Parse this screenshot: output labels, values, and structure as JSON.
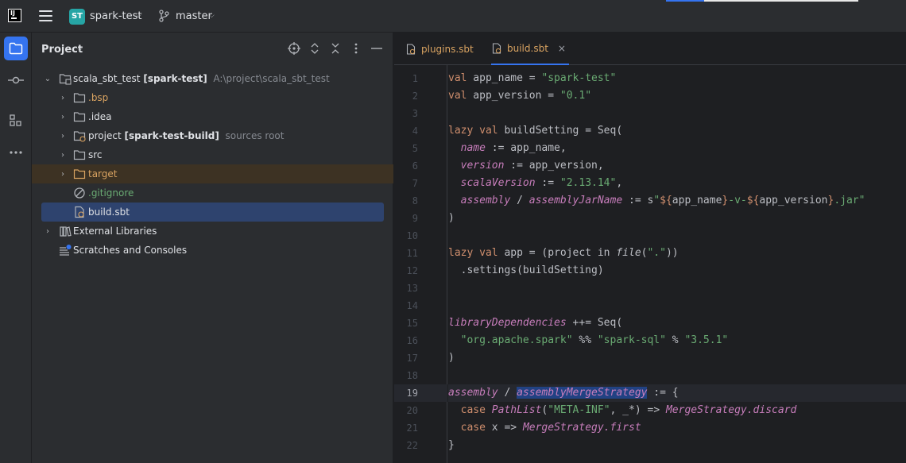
{
  "titlebar": {
    "logo_text": "IJ",
    "project_initials": "ST",
    "project_name": "spark-test",
    "branch": "master",
    "colors": {
      "project_badge": "#26a5a5",
      "accent": "#3574f0"
    }
  },
  "toolstrip": {
    "items": [
      "project-icon",
      "commit-icon",
      "structure-icon",
      "more-icon"
    ]
  },
  "project_panel": {
    "title": "Project",
    "tree": [
      {
        "label": "scala_sbt_test",
        "bold_suffix": "[spark-test]",
        "hint": "A:\\project\\scala_sbt_test",
        "icon": "module-folder-icon"
      },
      {
        "label": ".bsp",
        "icon": "folder-icon"
      },
      {
        "label": ".idea",
        "icon": "folder-icon"
      },
      {
        "label": "project",
        "bold_suffix": "[spark-test-build]",
        "hint": "sources root",
        "icon": "module-folder-icon"
      },
      {
        "label": "src",
        "icon": "folder-icon"
      },
      {
        "label": "target",
        "icon": "excluded-folder-icon"
      },
      {
        "label": ".gitignore",
        "icon": "ignored-file-icon"
      },
      {
        "label": "build.sbt",
        "icon": "sbt-file-icon"
      },
      {
        "label": "External Libraries",
        "icon": "libraries-icon"
      },
      {
        "label": "Scratches and Consoles",
        "icon": "scratches-icon"
      }
    ]
  },
  "editor": {
    "tabs": [
      {
        "label": "plugins.sbt",
        "active": false
      },
      {
        "label": "build.sbt",
        "active": true,
        "close": "×"
      }
    ],
    "current_line": 19,
    "lines": [
      [
        [
          "kw",
          "val"
        ],
        [
          "plain",
          " app_name = "
        ],
        [
          "str",
          "\"spark-test\""
        ]
      ],
      [
        [
          "kw",
          "val"
        ],
        [
          "plain",
          " app_version = "
        ],
        [
          "str",
          "\"0.1\""
        ]
      ],
      [],
      [
        [
          "kw",
          "lazy val"
        ],
        [
          "plain",
          " buildSetting = Seq("
        ]
      ],
      [
        [
          "plain",
          "  "
        ],
        [
          "it",
          "name"
        ],
        [
          "plain",
          " := app_name,"
        ]
      ],
      [
        [
          "plain",
          "  "
        ],
        [
          "it",
          "version"
        ],
        [
          "plain",
          " := app_version,"
        ]
      ],
      [
        [
          "plain",
          "  "
        ],
        [
          "it",
          "scalaVersion"
        ],
        [
          "plain",
          " := "
        ],
        [
          "str",
          "\"2.13.14\""
        ],
        [
          "plain",
          ","
        ]
      ],
      [
        [
          "plain",
          "  "
        ],
        [
          "it",
          "assembly"
        ],
        [
          "plain",
          " / "
        ],
        [
          "it",
          "assemblyJarName"
        ],
        [
          "plain",
          " := s"
        ],
        [
          "str",
          "\""
        ],
        [
          "kw",
          "${"
        ],
        [
          "plain",
          "app_name"
        ],
        [
          "kw",
          "}"
        ],
        [
          "str",
          "-v-"
        ],
        [
          "kw",
          "${"
        ],
        [
          "plain",
          "app_version"
        ],
        [
          "kw",
          "}"
        ],
        [
          "str",
          ".jar\""
        ]
      ],
      [
        [
          "plain",
          ")"
        ]
      ],
      [],
      [
        [
          "kw",
          "lazy val"
        ],
        [
          "plain",
          " app = (project in "
        ],
        [
          "itp",
          "file"
        ],
        [
          "plain",
          "("
        ],
        [
          "str",
          "\".\""
        ],
        [
          "plain",
          "))"
        ]
      ],
      [
        [
          "plain",
          "  .settings(buildSetting)"
        ]
      ],
      [],
      [],
      [
        [
          "it",
          "libraryDependencies"
        ],
        [
          "plain",
          " ++= Seq("
        ]
      ],
      [
        [
          "plain",
          "  "
        ],
        [
          "str",
          "\"org.apache.spark\""
        ],
        [
          "plain",
          " %% "
        ],
        [
          "str",
          "\"spark-sql\""
        ],
        [
          "plain",
          " % "
        ],
        [
          "str",
          "\"3.5.1\""
        ]
      ],
      [
        [
          "plain",
          ")"
        ]
      ],
      [],
      [
        [
          "it",
          "assembly"
        ],
        [
          "plain",
          " / "
        ],
        [
          "hl",
          "assemblyMergeStrategy"
        ],
        [
          "plain",
          " := {"
        ]
      ],
      [
        [
          "plain",
          "  "
        ],
        [
          "kw",
          "case"
        ],
        [
          "plain",
          " "
        ],
        [
          "it",
          "PathList"
        ],
        [
          "plain",
          "("
        ],
        [
          "str",
          "\"META-INF\""
        ],
        [
          "plain",
          ", _*) => "
        ],
        [
          "it",
          "MergeStrategy.discard"
        ]
      ],
      [
        [
          "plain",
          "  "
        ],
        [
          "kw",
          "case"
        ],
        [
          "plain",
          " x => "
        ],
        [
          "it",
          "MergeStrategy.first"
        ]
      ],
      [
        [
          "plain",
          "}"
        ]
      ]
    ]
  }
}
